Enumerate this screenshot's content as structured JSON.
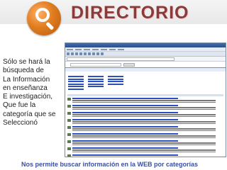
{
  "header": {
    "title": "DIRECTORIO",
    "logo_icon": "magnifier-icon"
  },
  "left_panel": {
    "lines": [
      "Sólo se hará la",
      "búsqueda de",
      "La Información",
      "en enseñanza",
      "E investigación,",
      "Que fue la",
      "categoría que se",
      "Seleccionó"
    ]
  },
  "footer": {
    "caption": "Nos permite buscar información en la WEB  por categorías"
  },
  "colors": {
    "title": "#8b3a3a",
    "caption": "#3a50a0",
    "logo_orange": "#e07d20"
  }
}
